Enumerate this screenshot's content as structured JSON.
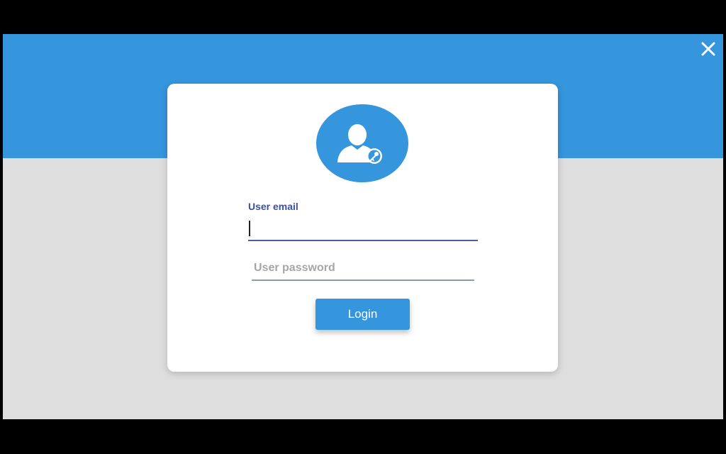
{
  "window": {
    "close_icon": "close-icon"
  },
  "login_card": {
    "avatar_icon": "user-key-icon",
    "email": {
      "label": "User email",
      "value": ""
    },
    "password": {
      "placeholder": "User password",
      "value": ""
    },
    "login_button_label": "Login"
  },
  "colors": {
    "accent": "#3595dd",
    "background": "#dedede",
    "card": "#ffffff",
    "label": "#3b4fa3"
  }
}
